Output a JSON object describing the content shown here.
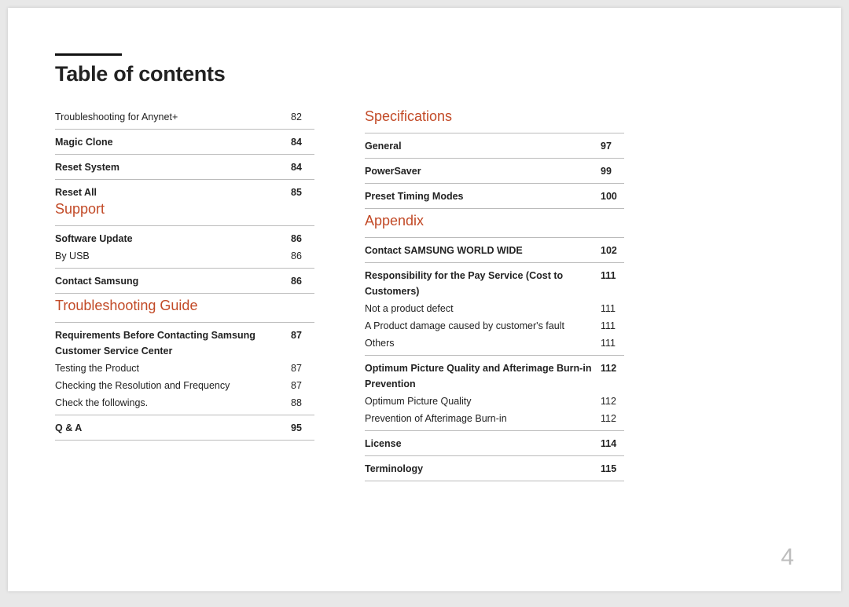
{
  "title": "Table of contents",
  "page_number": "4",
  "col1": {
    "top_entries": [
      {
        "label": "Troubleshooting for Anynet+",
        "page": "82",
        "bold": false
      },
      {
        "label": "Magic Clone",
        "page": "84",
        "bold": true
      },
      {
        "label": "Reset System",
        "page": "84",
        "bold": true
      },
      {
        "label": "Reset All",
        "page": "85",
        "bold": true
      }
    ],
    "support": {
      "heading": "Support",
      "groups": [
        {
          "rows": [
            {
              "label": "Software Update",
              "page": "86",
              "bold": true
            },
            {
              "label": "By USB",
              "page": "86",
              "bold": false
            }
          ]
        },
        {
          "rows": [
            {
              "label": "Contact Samsung",
              "page": "86",
              "bold": true
            }
          ]
        }
      ]
    },
    "troubleshooting": {
      "heading": "Troubleshooting Guide",
      "groups": [
        {
          "rows": [
            {
              "label": "Requirements Before Contacting Samsung Customer Service Center",
              "page": "87",
              "bold": true
            },
            {
              "label": "Testing the Product",
              "page": "87",
              "bold": false
            },
            {
              "label": "Checking the Resolution and Frequency",
              "page": "87",
              "bold": false
            },
            {
              "label": "Check the followings.",
              "page": "88",
              "bold": false
            }
          ]
        },
        {
          "rows": [
            {
              "label": "Q & A",
              "page": "95",
              "bold": true
            }
          ]
        }
      ]
    }
  },
  "col2": {
    "specifications": {
      "heading": "Specifications",
      "groups": [
        {
          "rows": [
            {
              "label": "General",
              "page": "97",
              "bold": true
            }
          ]
        },
        {
          "rows": [
            {
              "label": "PowerSaver",
              "page": "99",
              "bold": true
            }
          ]
        },
        {
          "rows": [
            {
              "label": "Preset Timing Modes",
              "page": "100",
              "bold": true
            }
          ]
        }
      ]
    },
    "appendix": {
      "heading": "Appendix",
      "groups": [
        {
          "rows": [
            {
              "label": "Contact SAMSUNG WORLD WIDE",
              "page": "102",
              "bold": true
            }
          ]
        },
        {
          "rows": [
            {
              "label": "Responsibility for the Pay Service (Cost to Customers)",
              "page": "111",
              "bold": true
            },
            {
              "label": "Not a product defect",
              "page": "111",
              "bold": false
            },
            {
              "label": "A Product damage caused by customer's fault",
              "page": "111",
              "bold": false
            },
            {
              "label": "Others",
              "page": "111",
              "bold": false
            }
          ]
        },
        {
          "rows": [
            {
              "label": "Optimum Picture Quality and Afterimage Burn-in Prevention",
              "page": "112",
              "bold": true
            },
            {
              "label": "Optimum Picture Quality",
              "page": "112",
              "bold": false
            },
            {
              "label": "Prevention of Afterimage Burn-in",
              "page": "112",
              "bold": false
            }
          ]
        },
        {
          "rows": [
            {
              "label": "License",
              "page": "114",
              "bold": true
            }
          ]
        },
        {
          "rows": [
            {
              "label": "Terminology",
              "page": "115",
              "bold": true
            }
          ]
        }
      ]
    }
  }
}
